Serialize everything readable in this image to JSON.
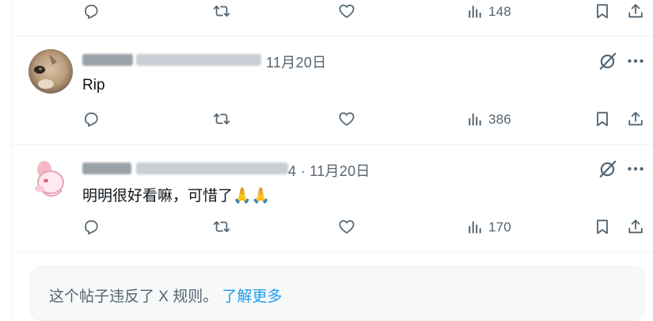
{
  "top_actions": {
    "views": "148"
  },
  "replies": [
    {
      "date": "11月20日",
      "text": "Rip",
      "views": "386",
      "handle_tail": ""
    },
    {
      "date": "11月20日",
      "text": "明明很好看嘛，可惜了",
      "emoji": "🙏🙏",
      "views": "170",
      "handle_tail": "4 · "
    }
  ],
  "notice": {
    "text": "这个帖子违反了 X 规则。",
    "link": "了解更多"
  },
  "icons": [
    "reply-icon",
    "retweet-icon",
    "like-icon",
    "views-icon",
    "bookmark-icon",
    "share-icon",
    "grok-icon",
    "more-icon"
  ]
}
